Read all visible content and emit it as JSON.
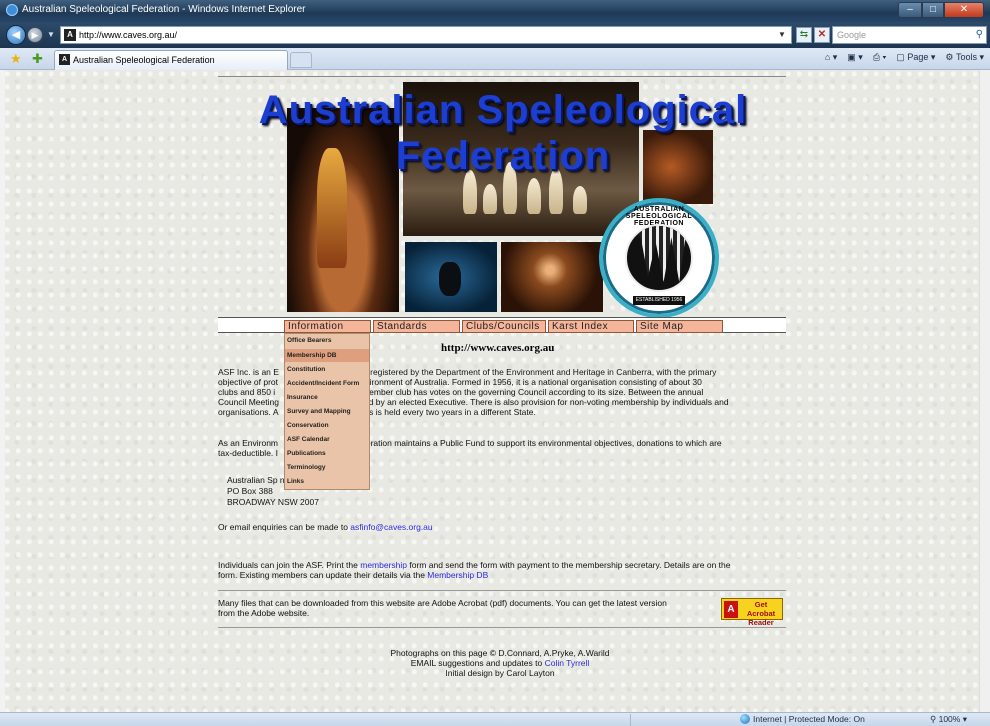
{
  "window": {
    "title": "Australian Speleological Federation - Windows Internet Explorer"
  },
  "address_bar": {
    "url": "http://www.caves.org.au/",
    "search_placeholder": "Google"
  },
  "tab": {
    "label": "Australian Speleological Federation"
  },
  "command_bar": {
    "page_label": "Page",
    "tools_label": "Tools"
  },
  "banner": {
    "title_line1": "Australian Speleological",
    "title_line2": "Federation",
    "logo_ring_text": "AUSTRALIAN SPELEOLOGICAL FEDERATION",
    "logo_established": "ESTABLISHED 1956"
  },
  "nav": {
    "items": [
      "Information",
      "Standards",
      "Clubs/Councils",
      "Karst Index",
      "Site Map"
    ]
  },
  "url_caption": "http://www.caves.org.au",
  "dropdown": {
    "items": [
      "Office Bearers",
      "Membership DB",
      "Constitution",
      "Accident/Incident Form",
      "Insurance",
      "Survey and Mapping",
      "Conservation",
      "ASF Calendar",
      "Publications",
      "Terminology",
      "Links"
    ],
    "active_index": 1
  },
  "body": {
    "para1_l1": "ASF Inc. is an E                           sation, registered by the Department of the Environment and Heritage in Canberra, with the primary",
    "para1_l2": "objective of prot                          arst environment of Australia. Formed in 1956, it is a national organisation consisting of about 30",
    "para1_l3": "clubs and 850 i                            n full-member club has votes on the governing Council according to its size. Between the annual",
    "para1_l4": "Council Meeting                           overned by an elected Executive. There is also provision for non-voting membership by individuals and",
    "para1_l5": "organisations. A                           ield trips is held every two years in a different State.",
    "para2_l1": "As an Environm                            e Federation maintains a Public Fund to support its environmental objectives, donations to which are",
    "para2_l2": "tax-deductible. I",
    "address_l1": "Australian Sp                         n",
    "address_l2": "PO Box 388",
    "address_l3": "BROADWAY NSW 2007",
    "email_prefix": "Or email enquiries can be made to ",
    "email_link": "asfinfo@caves.org.au",
    "join_l1_a": "Individuals can join the ASF. Print the ",
    "join_l1_link": "membership",
    "join_l1_b": " form and send the form with payment to the membership secretary. Details are on the",
    "join_l2_a": "form. Existing members can update their details via the ",
    "join_l2_link": "Membership DB",
    "pdf_l1": "Many files that can be downloaded from this website are Adobe Acrobat (pdf) documents. You can get the latest version",
    "pdf_l2": "from the Adobe website.",
    "acrobat_line1": "Get Acrobat",
    "acrobat_line2": "Reader",
    "credits_l1": "Photographs on this page © D.Connard, A.Pryke, A.Warild",
    "credits_l2_a": "EMAIL suggestions and updates to ",
    "credits_l2_link": "Colin Tyrrell",
    "credits_l3": "Initial design by Carol Layton"
  },
  "status_bar": {
    "zone": "Internet | Protected Mode: On",
    "zoom": "100%"
  }
}
